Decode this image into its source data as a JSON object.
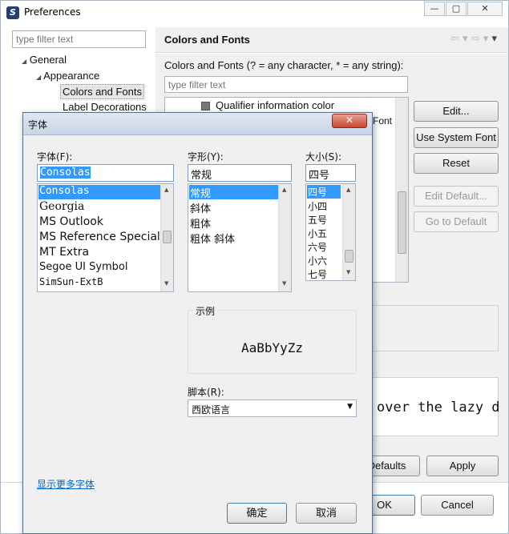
{
  "window": {
    "title": "Preferences",
    "controls": [
      "—",
      "▢",
      "✕"
    ]
  },
  "sidebar": {
    "filter_placeholder": "type filter text",
    "tree": [
      {
        "label": "General",
        "expander": "◢"
      },
      {
        "label": "Appearance",
        "expander": "◢"
      },
      {
        "label": "Colors and Fonts"
      },
      {
        "label": "Label Decorations"
      }
    ]
  },
  "page": {
    "title": "Colors and Fonts",
    "nav_icons": [
      "⇦",
      "▾",
      "⇨",
      "▾",
      "▾"
    ],
    "description": "Colors and Fonts (? = any character, * = any string):",
    "filter_placeholder": "type filter text",
    "list": {
      "visible_item": "Qualifier information color",
      "partial_right": "Font"
    },
    "buttons": {
      "edit": "Edit...",
      "use_system_font": "Use System Font",
      "reset": "Reset",
      "edit_default": "Edit Default...",
      "go_to_default": "Go to Default"
    },
    "preview_text": "over the lazy d",
    "restore_defaults": "Defaults",
    "apply": "Apply",
    "ok": "OK",
    "cancel": "Cancel"
  },
  "font_dialog": {
    "title": "字体",
    "close": "✕",
    "font_label": "字体(F):",
    "font_value": "Consolas",
    "fonts": [
      "Consolas",
      "Georgia",
      "MS Outlook",
      "MS Reference Specialty",
      "MT Extra",
      "Segoe UI Symbol",
      "SimSun-ExtB"
    ],
    "style_label": "字形(Y):",
    "style_value": "常规",
    "styles": [
      "常规",
      "斜体",
      "粗体",
      "粗体 斜体"
    ],
    "size_label": "大小(S):",
    "size_value": "四号",
    "sizes": [
      "四号",
      "小四",
      "五号",
      "小五",
      "六号",
      "小六",
      "七号"
    ],
    "sample_label": "示例",
    "sample_text": "AaBbYyZz",
    "script_label": "脚本(R):",
    "script_value": "西欧语言",
    "more_fonts_link": "显示更多字体",
    "ok": "确定",
    "cancel": "取消"
  }
}
